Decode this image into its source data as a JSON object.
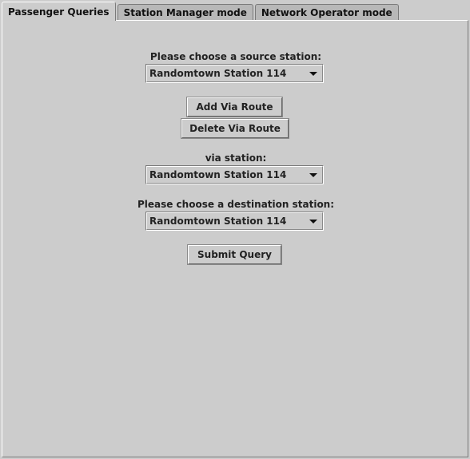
{
  "tabs": [
    {
      "label": "Passenger Queries",
      "active": true
    },
    {
      "label": "Station Manager mode",
      "active": false
    },
    {
      "label": "Network Operator mode",
      "active": false
    }
  ],
  "form": {
    "source_label": "Please choose a source station:",
    "source_value": "Randomtown Station 114",
    "add_via_label": "Add Via Route",
    "delete_via_label": "Delete Via Route",
    "via_label": "via station:",
    "via_value": "Randomtown Station 114",
    "destination_label": "Please choose a destination station:",
    "destination_value": "Randomtown Station 114",
    "submit_label": "Submit Query"
  },
  "icons": {
    "dropdown": "chevron-down-icon"
  },
  "colors": {
    "background": "#cccccc",
    "border_dark": "#7a7a7a",
    "border_light": "#ffffff"
  }
}
